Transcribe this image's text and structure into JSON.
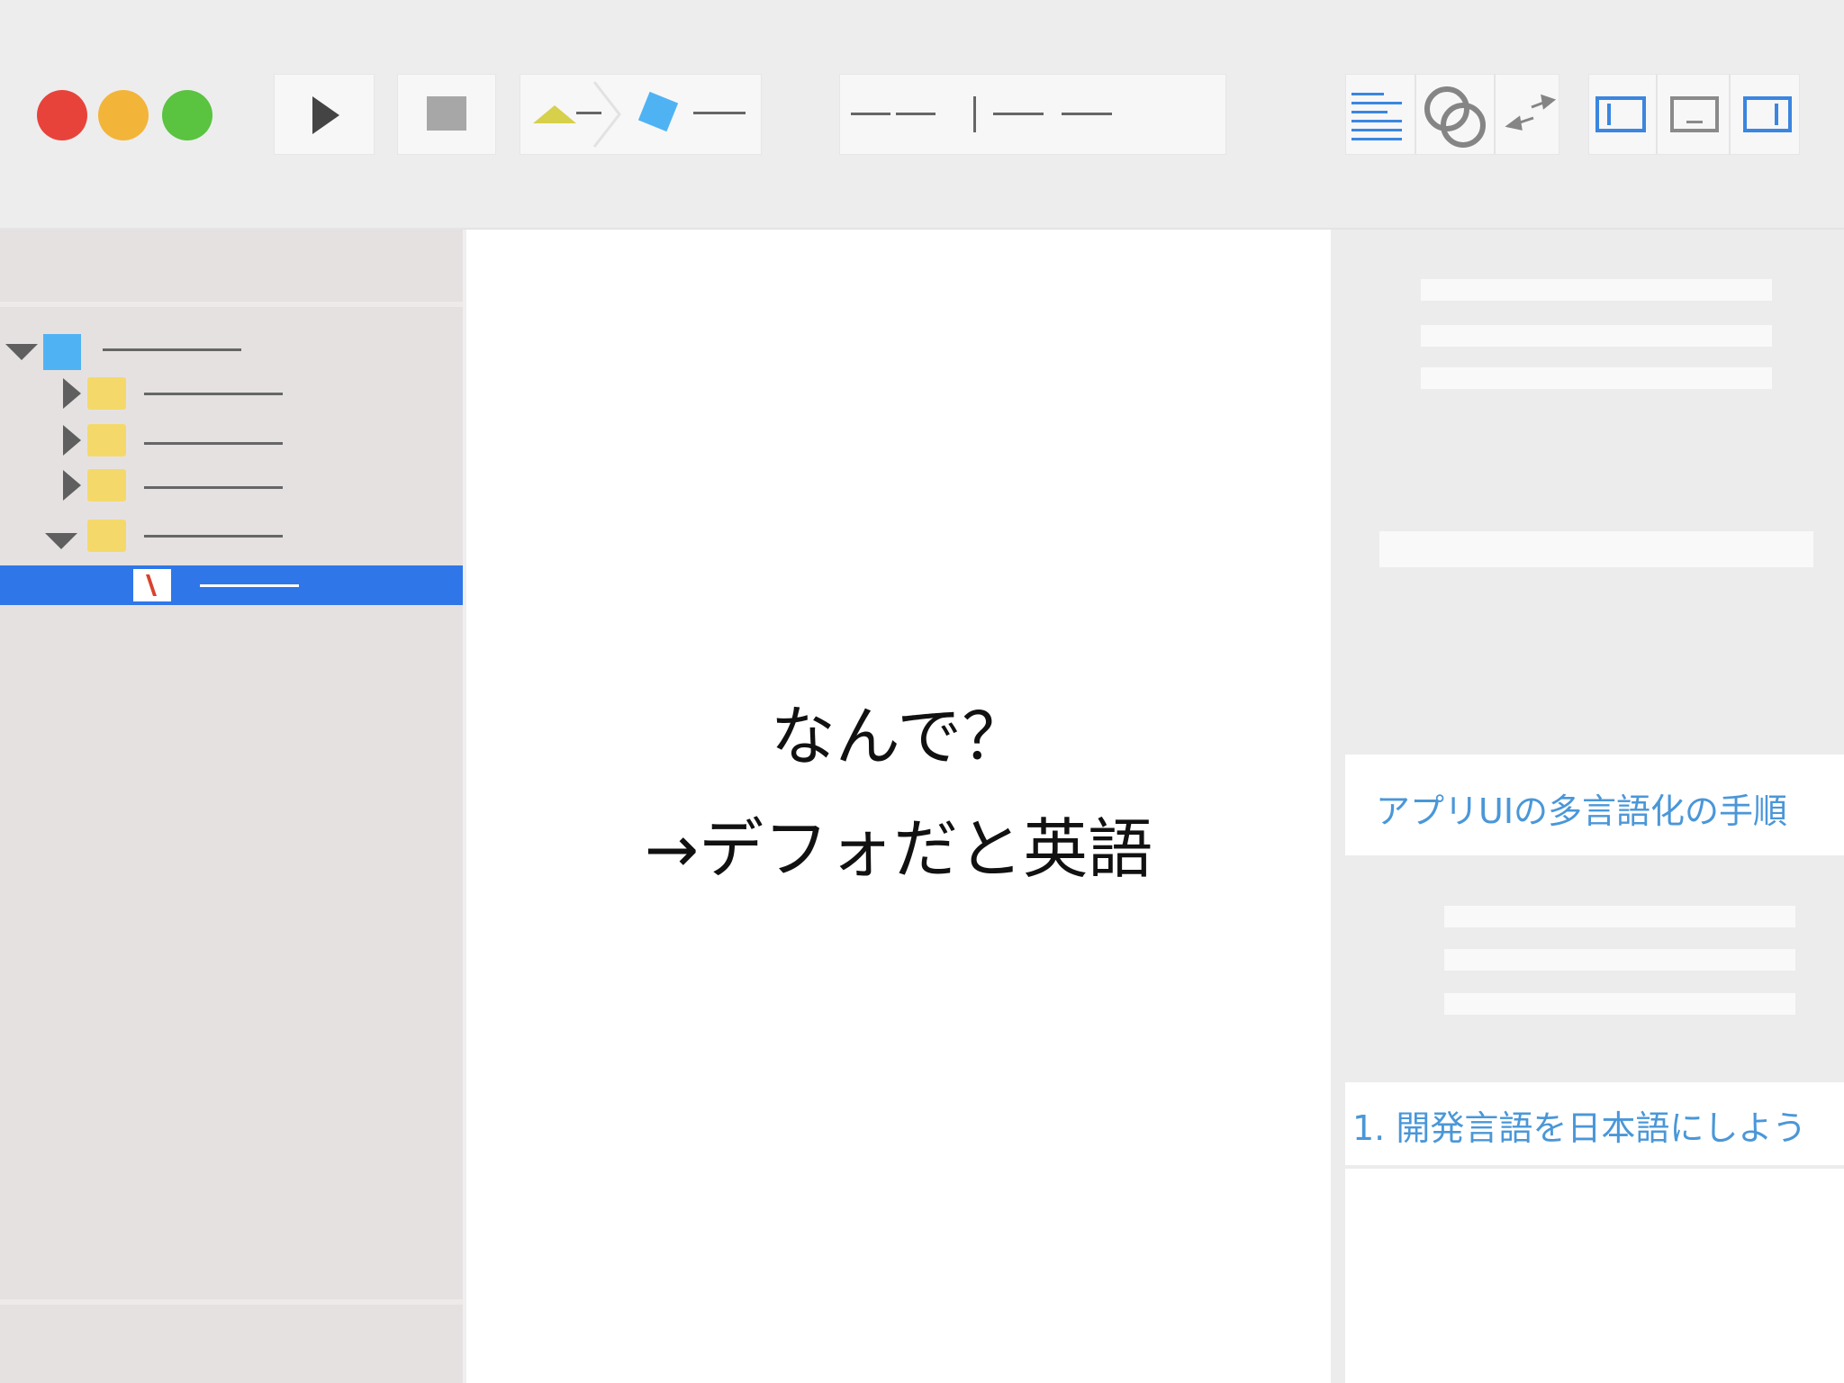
{
  "window": {
    "traffic_lights": [
      {
        "name": "close",
        "color": "#e8433b"
      },
      {
        "name": "minimize",
        "color": "#f2b53a"
      },
      {
        "name": "zoom",
        "color": "#5ac340"
      }
    ]
  },
  "toolbar": {
    "run_icon": "play-icon",
    "stop_icon": "stop-icon",
    "scheme_icons": [
      "target-triangle-icon",
      "device-diamond-icon"
    ],
    "right_icons": [
      "standard-editor-icon",
      "assistant-editor-icon",
      "version-editor-icon",
      "navigator-toggle-icon",
      "debug-area-toggle-icon",
      "utilities-toggle-icon"
    ],
    "accent_color": "#3a86e0"
  },
  "navigator": {
    "selection_color": "#2f77e8",
    "folder_color": "#f4d96a",
    "project_color": "#4fb3f3"
  },
  "editor": {
    "line1": "なんで？",
    "line2": "→デフォだと英語"
  },
  "inspector": {
    "link1": "アプリUIの多言語化の手順",
    "link2": "1. 開発言語を日本語にしよう"
  }
}
